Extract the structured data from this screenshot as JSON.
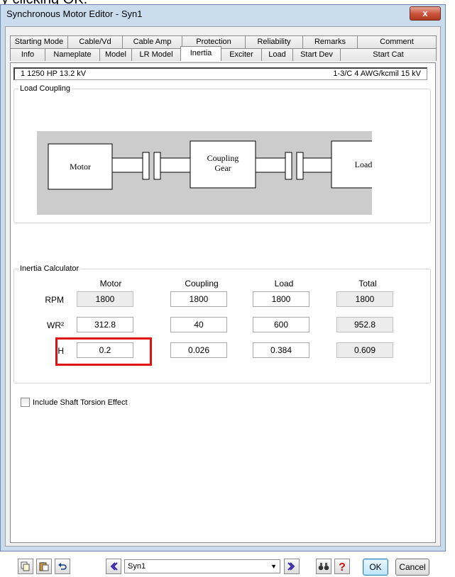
{
  "caption": "y clicking OK.",
  "window": {
    "title": "Synchronous Motor Editor - Syn1",
    "close_glyph": "x"
  },
  "tabs": {
    "row1": [
      "Starting Mode",
      "Cable/Vd",
      "Cable Amp",
      "Protection",
      "Reliability",
      "Remarks",
      "Comment"
    ],
    "row2": [
      "Info",
      "Nameplate",
      "Model",
      "LR Model",
      "Inertia",
      "Exciter",
      "Load",
      "Start Dev",
      "Start Cat"
    ],
    "active": "Inertia"
  },
  "info": {
    "left": "1  1250 HP  13.2 kV",
    "right": "1-3/C  4 AWG/kcmil  15 kV"
  },
  "load_coupling": {
    "legend": "Load Coupling",
    "motor_label": "Motor",
    "gear_label_1": "Coupling",
    "gear_label_2": "Gear",
    "load_label": "Load",
    "colors": {
      "background": "#cccccc",
      "box": "#ffffff"
    }
  },
  "inertia": {
    "legend": "Inertia Calculator",
    "columns": [
      "Motor",
      "Coupling",
      "Load",
      "Total"
    ],
    "rows": [
      {
        "label": "RPM",
        "values": [
          "1800",
          "1800",
          "1800",
          "1800"
        ]
      },
      {
        "label": "WR²",
        "values": [
          "312.8",
          "40",
          "600",
          "952.8"
        ]
      },
      {
        "label": "H",
        "values": [
          "0.2",
          "0.026",
          "0.384",
          "0.609"
        ]
      }
    ],
    "highlight_color": "#e01414"
  },
  "shaft_torsion": {
    "label": "Include Shaft Torsion Effect",
    "checked": false
  },
  "bottom": {
    "combo_value": "Syn1",
    "ok_label": "OK",
    "cancel_label": "Cancel",
    "icons": [
      "copy-icon",
      "paste-icon",
      "undo-icon",
      "previous-icon",
      "next-icon",
      "find-icon",
      "help-icon"
    ]
  }
}
